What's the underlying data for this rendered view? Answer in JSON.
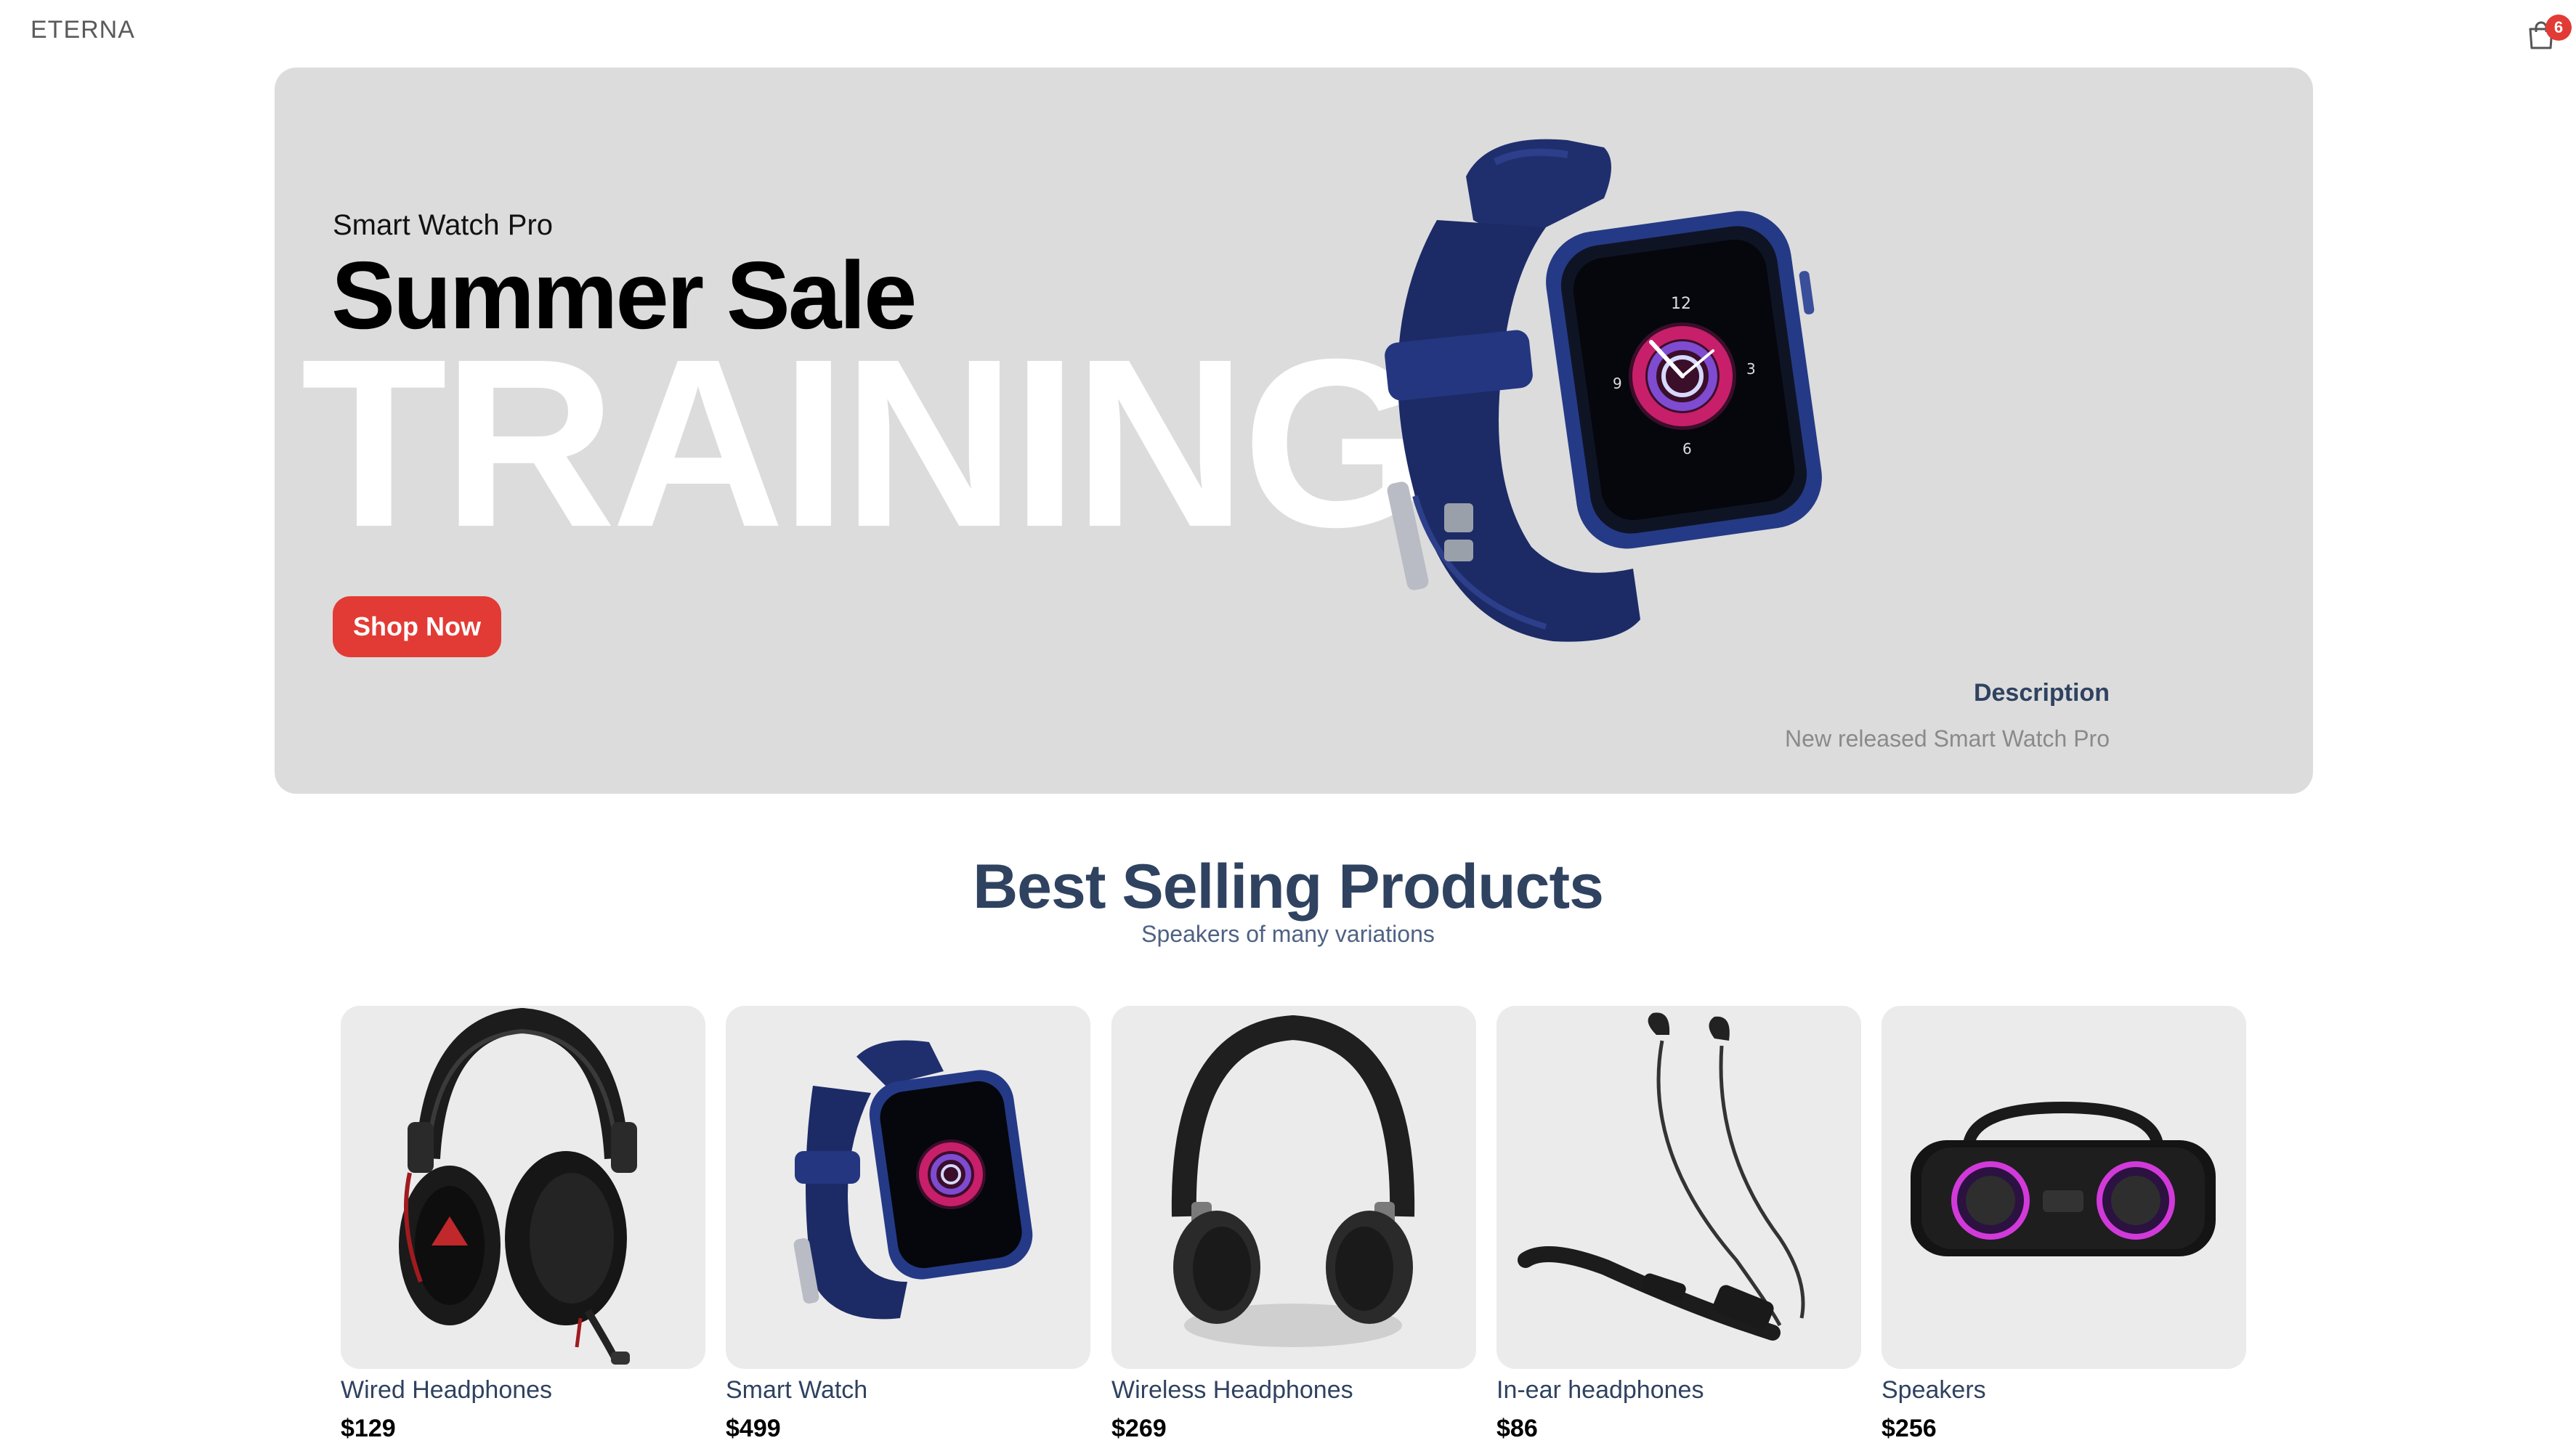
{
  "header": {
    "logo": "ETERNA",
    "cart_icon": "shopping-bag-icon",
    "cart_count": "6"
  },
  "hero": {
    "subtitle": "Smart Watch Pro",
    "title": "Summer Sale",
    "background_word": "TRAINING",
    "button_label": "Shop Now",
    "description_label": "Description",
    "description_text": "New released Smart Watch Pro",
    "image": "smart-watch-image"
  },
  "best_selling": {
    "title": "Best Selling Products",
    "subtitle": "Speakers of many variations",
    "products": [
      {
        "name": "Wired Headphones",
        "price": "$129",
        "image": "wired-headphones-image"
      },
      {
        "name": "Smart Watch",
        "price": "$499",
        "image": "smart-watch-image"
      },
      {
        "name": "Wireless Headphones",
        "price": "$269",
        "image": "wireless-headphones-image"
      },
      {
        "name": "In-ear headphones",
        "price": "$86",
        "image": "in-ear-headphones-image"
      },
      {
        "name": "Speakers",
        "price": "$256",
        "image": "speaker-image"
      }
    ]
  },
  "colors": {
    "accent": "#e23b35",
    "heading": "#2f4260",
    "hero_bg": "#dcdcdc",
    "card_bg": "#ebebeb"
  }
}
